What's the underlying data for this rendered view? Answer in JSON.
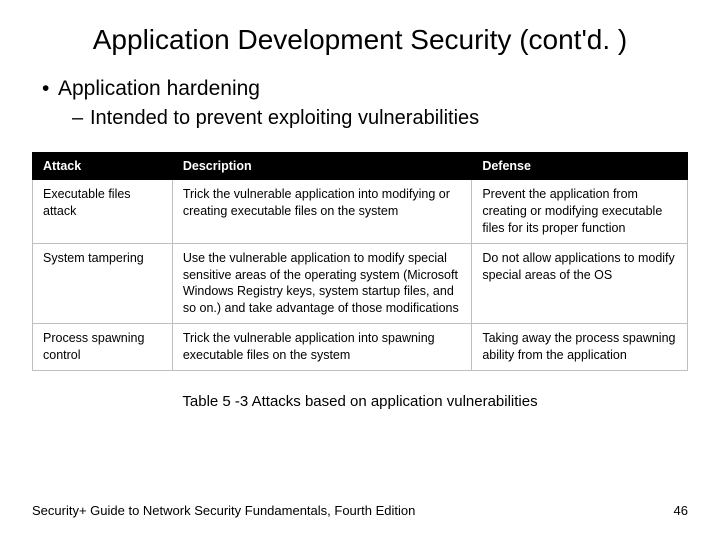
{
  "title": "Application Development Security (cont'd. )",
  "bullet1": "Application hardening",
  "bullet2": "Intended to prevent exploiting vulnerabilities",
  "table": {
    "headers": [
      "Attack",
      "Description",
      "Defense"
    ],
    "rows": [
      {
        "attack": "Executable files attack",
        "description": "Trick the vulnerable application into modifying or creating executable files on the system",
        "defense": "Prevent the application from creating or modifying executable files for its proper function"
      },
      {
        "attack": "System tampering",
        "description": "Use the vulnerable application to modify special sensitive areas of the operating system (Microsoft Windows Registry keys, system startup files, and so on.) and take advantage of those modifications",
        "defense": "Do not allow applications to modify special areas of the OS"
      },
      {
        "attack": "Process spawning control",
        "description": "Trick the vulnerable application into spawning executable files on the system",
        "defense": "Taking away the process spawning ability from the application"
      }
    ]
  },
  "caption": "Table 5 -3 Attacks based on application vulnerabilities",
  "footer_left": "Security+ Guide to Network Security Fundamentals, Fourth Edition",
  "footer_right": "46"
}
